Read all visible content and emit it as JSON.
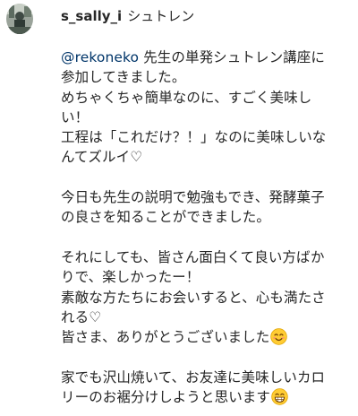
{
  "comment": {
    "username": "s_sally_i",
    "display_name": "シュトレン",
    "mention": "@rekoneko",
    "lines": [
      " 先生の単発シュトレン講座に",
      "参加してきました。",
      "めちゃくちゃ簡単なのに、すごく美味し",
      "い！",
      "工程は「これだけ？！」なのに美味しいな",
      "んてズルイ♡",
      "",
      "今日も先生の説明で勉強もでき、発酵菓子",
      "の良さを知ることができました。",
      "",
      "それにしても、皆さん面白くて良い方ばか",
      "りで、楽しかったー！",
      "素敵な方たちにお会いすると、心も満たさ",
      "れる♡",
      "皆さま、ありがとうございました",
      "",
      "家でも沢山焼いて、お友達に美味しいカロ",
      "リーのお裾分けしようと思います"
    ]
  }
}
